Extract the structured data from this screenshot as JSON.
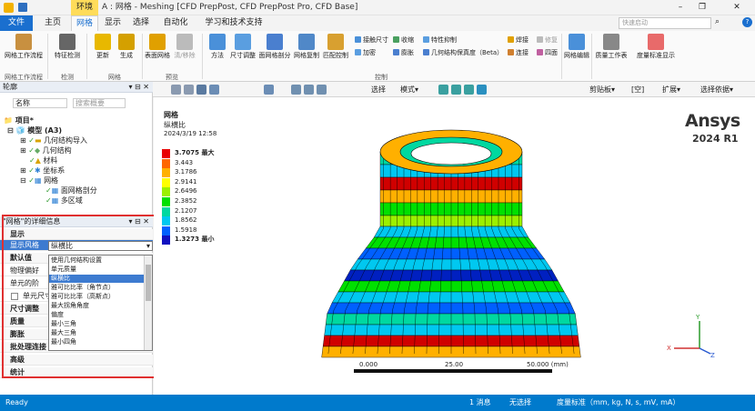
{
  "titlebar": {
    "context_tab": "环境",
    "title": "A : 网格 - Meshing [CFD PrepPost, CFD PrepPost Pro, CFD Base]",
    "search_placeholder": "快速启动"
  },
  "ribbon_tabs": [
    "文件",
    "主页",
    "网格",
    "显示",
    "选择",
    "自动化",
    "学习和技术支持"
  ],
  "ribbon": {
    "workflow": "网格工作流程",
    "check": "特征检测",
    "update": "更新",
    "generate": "生成",
    "surface_mesh": "表面网格",
    "clean": "清/移除",
    "method": "方法",
    "size": "尺寸调整",
    "face_meshing": "面网格剖分",
    "mesh_copy": "网格复制",
    "match_control": "匹配控制",
    "contact_sizing": "接触尺寸",
    "refinement": "加密",
    "shrink": "收缩",
    "edge_bias": "膨胀",
    "feature_suppress": "特性抑制",
    "geom_fidelity": "几何结构保真度（Beta）",
    "weld": "焊接",
    "connect": "连接",
    "repair": "修复",
    "quad": "四面",
    "mesh_edit": "网格编辑",
    "quality_workbook": "质量工作表",
    "metric_display": "度量标准显示",
    "groups": [
      "网格工作流程",
      "检测",
      "网格",
      "预览",
      "控制"
    ]
  },
  "toolbar": {
    "select_label": "选择",
    "mode_label": "模式▾",
    "clipboard": "剪贴板▾",
    "empty": "[空]",
    "expand": "扩展▾",
    "select_by": "选择依据▾"
  },
  "outline": {
    "header": "轮廓",
    "name_label": "名称",
    "search_placeholder": "搜索概要",
    "items": [
      "项目*",
      "模型 (A3)",
      "几何结构导入",
      "几何结构",
      "材料",
      "坐标系",
      "网格",
      "面网格剖分",
      "多区域"
    ]
  },
  "details": {
    "header": "\"网格\"的详细信息",
    "rows": [
      "显示",
      "显示风格",
      "默认值",
      "物理偏好",
      "单元的阶",
      "单元尺寸",
      "尺寸调整",
      "质量",
      "膨胀",
      "批处理连接",
      "高级",
      "统计"
    ],
    "display_style_value": "纵横比",
    "options": [
      "使用几何结构设置",
      "单元质量",
      "纵横比",
      "雅可比比率（角节点）",
      "雅可比比率（高斯点）",
      "最大拐角角度",
      "偏度",
      "最小三角",
      "最大三角",
      "最小四角"
    ],
    "selected_option": "纵横比"
  },
  "viewport": {
    "label": "网格",
    "metric": "纵横比",
    "date": "2024/3/19 12:58",
    "brand": "Ansys",
    "version": "2024 R1",
    "legend_values": [
      "3.7075 最大",
      "3.443",
      "3.1786",
      "2.9141",
      "2.6496",
      "2.3852",
      "2.1207",
      "1.8562",
      "1.5918",
      "1.3273 最小"
    ],
    "legend_colors": [
      "#e80000",
      "#ff6600",
      "#ffb000",
      "#ffff00",
      "#9cf000",
      "#00e000",
      "#00d8a0",
      "#00c8f0",
      "#0060ff",
      "#1010c0"
    ],
    "scale_ticks": [
      "0.000",
      "25.00",
      "50.000 (mm)"
    ],
    "axis": {
      "x": "X",
      "y": "Y",
      "z": "Z"
    }
  },
  "statusbar": {
    "ready": "Ready",
    "messages": "1 消息",
    "selection": "无选择",
    "metric": "度量标准（mm, kg, N, s, mV, mA）"
  }
}
